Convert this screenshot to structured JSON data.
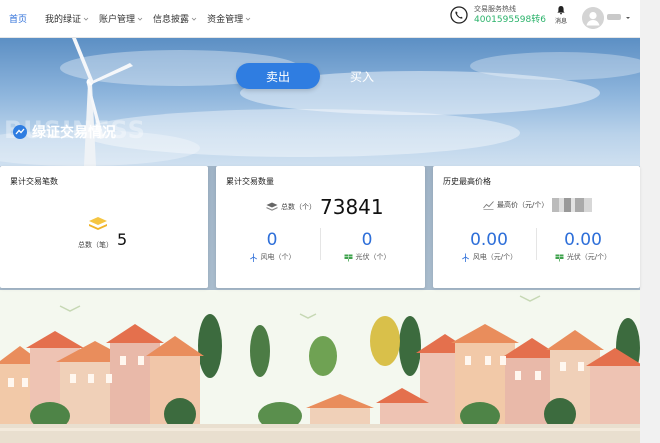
{
  "nav": {
    "items": [
      {
        "label": "首页",
        "dropdown": false,
        "active": true
      },
      {
        "label": "我的绿证",
        "dropdown": true
      },
      {
        "label": "账户管理",
        "dropdown": true
      },
      {
        "label": "信息披露",
        "dropdown": true
      },
      {
        "label": "资金管理",
        "dropdown": true
      }
    ],
    "hotline_label": "交易服务热线",
    "hotline_number": "4001595598转6",
    "message_label": "消息"
  },
  "hero": {
    "sell_label": "卖出",
    "buy_label": "买入",
    "title": "绿证交易情况",
    "watermark": "BUSINESS"
  },
  "cards": {
    "count": {
      "title": "累计交易笔数",
      "total_label": "总数（笔）",
      "total_value": "5"
    },
    "quantity": {
      "title": "累计交易数量",
      "total_label": "总数（个）",
      "total_value": "73841",
      "wind_value": "0",
      "wind_label": "风电（个）",
      "solar_value": "0",
      "solar_label": "光伏（个）"
    },
    "price": {
      "title": "历史最高价格",
      "max_label": "最高价（元/个）",
      "wind_value": "0.00",
      "wind_label": "风电（元/个）",
      "solar_value": "0.00",
      "solar_label": "光伏（元/个）"
    }
  },
  "colors": {
    "accent": "#2e6fd9",
    "hotline": "#2bb36b",
    "sell_button": "#2f7de1"
  }
}
